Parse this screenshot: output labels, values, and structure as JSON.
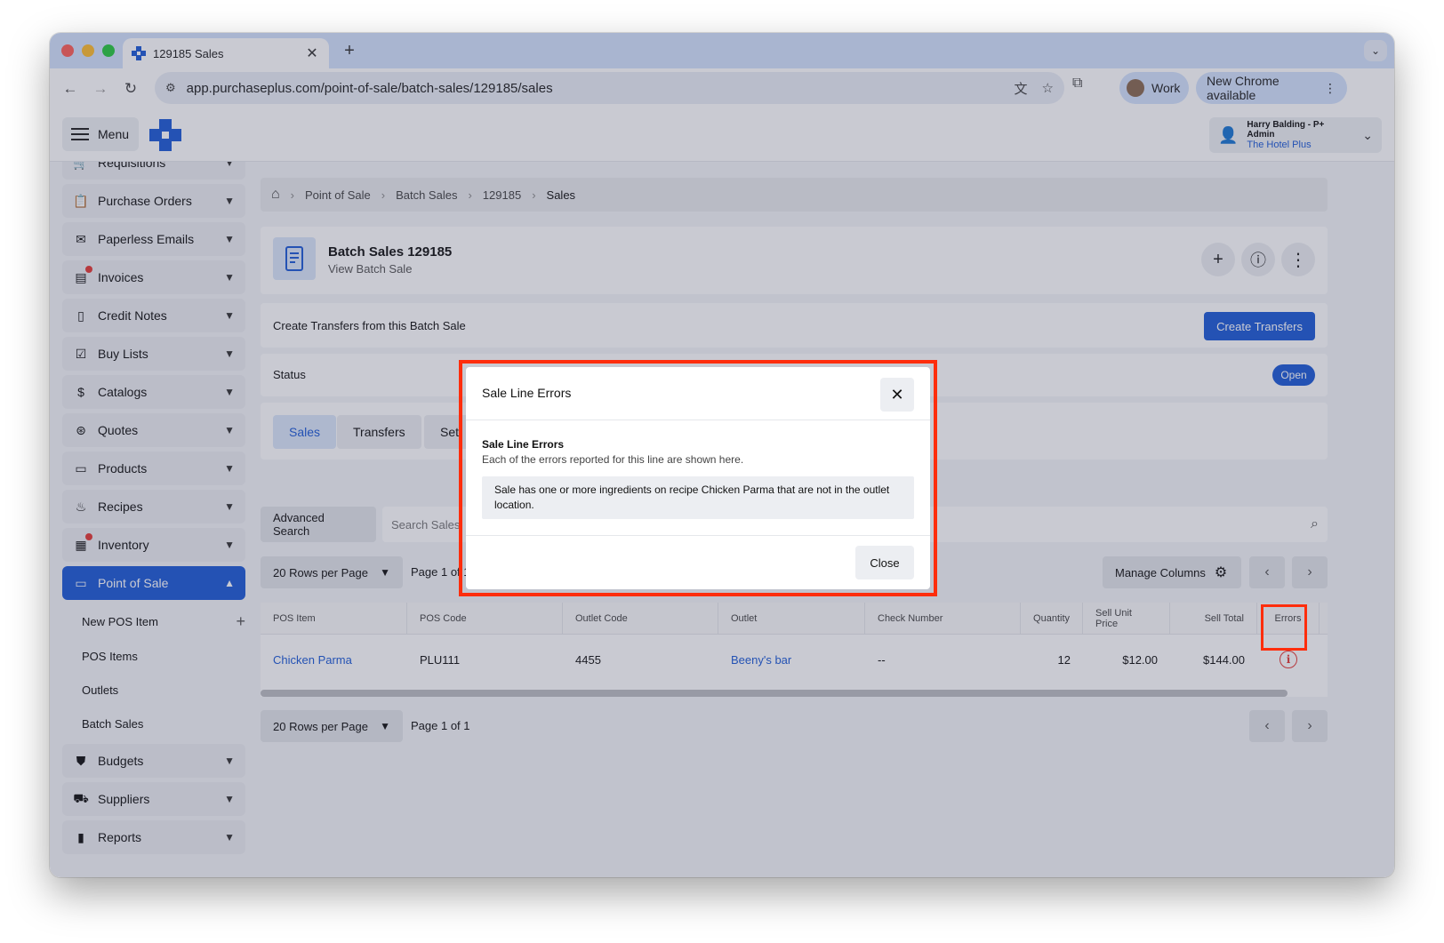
{
  "browser": {
    "tab_title": "129185 Sales",
    "tab_close": "✕",
    "new_tab": "+",
    "tab_menu": "⌄",
    "url": "app.purchaseplus.com/point-of-sale/batch-sales/129185/sales",
    "profile_label": "Work",
    "update_label": "New Chrome available",
    "update_menu": "⋮"
  },
  "header": {
    "menu_label": "Menu",
    "user_name": "Harry Balding - P+ Admin",
    "user_org": "The Hotel Plus"
  },
  "sidebar": {
    "items": [
      {
        "label": "Requisitions",
        "icon": "cart-icon"
      },
      {
        "label": "Purchase Orders",
        "icon": "clipboard-icon"
      },
      {
        "label": "Paperless Emails",
        "icon": "mail-icon"
      },
      {
        "label": "Invoices",
        "icon": "invoice-icon",
        "notification": true
      },
      {
        "label": "Credit Notes",
        "icon": "document-icon"
      },
      {
        "label": "Buy Lists",
        "icon": "checklist-icon"
      },
      {
        "label": "Catalogs",
        "icon": "catalog-icon"
      },
      {
        "label": "Quotes",
        "icon": "dollar-icon"
      },
      {
        "label": "Products",
        "icon": "box-icon"
      },
      {
        "label": "Recipes",
        "icon": "recipe-icon"
      },
      {
        "label": "Inventory",
        "icon": "inventory-icon",
        "notification": true
      },
      {
        "label": "Point of Sale",
        "icon": "pos-icon",
        "active": true
      },
      {
        "label": "Budgets",
        "icon": "shield-dollar-icon"
      },
      {
        "label": "Suppliers",
        "icon": "truck-icon"
      },
      {
        "label": "Reports",
        "icon": "bar-chart-icon"
      }
    ],
    "pos_sub_items": [
      "New POS Item",
      "POS Items",
      "Outlets",
      "Batch Sales"
    ]
  },
  "breadcrumbs": [
    "Point of Sale",
    "Batch Sales",
    "129185",
    "Sales"
  ],
  "batch": {
    "title": "Batch Sales 129185",
    "subtitle": "View Batch Sale"
  },
  "transfers": {
    "text": "Create Transfers from this Batch Sale",
    "button": "Create Transfers"
  },
  "status": {
    "label": "Status",
    "value": "Open"
  },
  "tabs": [
    "Sales",
    "Transfers",
    "Sett"
  ],
  "search": {
    "advanced_label": "Advanced Search",
    "placeholder": "Search Sales"
  },
  "pagination": {
    "rows_label": "20 Rows per Page",
    "page_label_top": "Page 1 of 1",
    "page_label_bottom": "Page 1 of 1",
    "manage_columns": "Manage Columns"
  },
  "table": {
    "headers": [
      "POS Item",
      "POS Code",
      "Outlet Code",
      "Outlet",
      "Check Number",
      "Quantity",
      "Sell Unit Price",
      "Sell Total",
      "Errors"
    ],
    "rows": [
      {
        "pos_item": "Chicken Parma",
        "pos_code": "PLU111",
        "outlet_code": "4455",
        "outlet": "Beeny's bar",
        "check_number": "--",
        "quantity": "12",
        "sell_unit_price": "$12.00",
        "sell_total": "$144.00"
      }
    ]
  },
  "modal": {
    "title": "Sale Line Errors",
    "section_title": "Sale Line Errors",
    "section_desc": "Each of the errors reported for this line are shown here.",
    "message": "Sale has one or more ingredients on recipe Chicken Parma that are not in the outlet location.",
    "close_label": "Close"
  },
  "colors": {
    "accent": "#1d5bd6",
    "highlight": "#ff2d0c",
    "error": "#e53935"
  }
}
